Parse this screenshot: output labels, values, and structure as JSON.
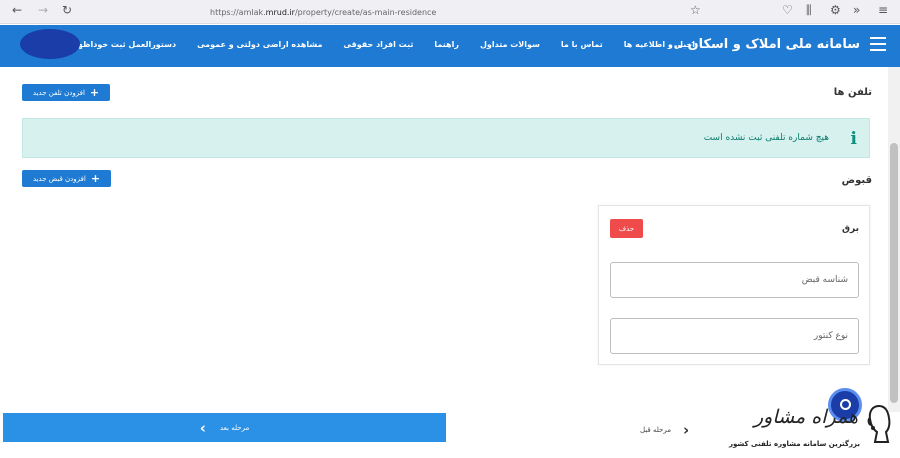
{
  "browser": {
    "url_prefix": "https://amlak.",
    "url_domain": "mrud.ir",
    "url_path": "/property/create/as-main-residence"
  },
  "header": {
    "brand": "سامانه ملی املاک و اسکان ...",
    "nav": [
      "اخبار و اطلاعیه ها",
      "تماس با ما",
      "سوالات متداول",
      "راهنما",
      "ثبت افراد حقوقی",
      "مشاهده اراضی دولتی و عمومی",
      "دستورالعمل ثبت خوداظهاری"
    ]
  },
  "phones": {
    "label": "تلفن ها",
    "add_button": "افزودن تلفن جدید",
    "empty_message": "هیچ شماره تلفنی ثبت نشده است"
  },
  "bills": {
    "label": "قبوض",
    "add_button": "افزودن قبض جدید",
    "card": {
      "title": "برق",
      "delete_button": "حذف",
      "field_bill_id": "شناسه قبض",
      "field_meter_type": "نوع کنتور"
    }
  },
  "footer": {
    "next_button": "مرحله بعد",
    "prev_button": "مرحله قبل"
  },
  "watermark": {
    "brand": "همراه مشاور",
    "tagline": "بزرگترین سامانه مشاوره تلفنی کشور"
  },
  "colors": {
    "primary": "#1e7ad2",
    "alert_bg": "#d6f1ee",
    "delete": "#ef4b4b"
  }
}
